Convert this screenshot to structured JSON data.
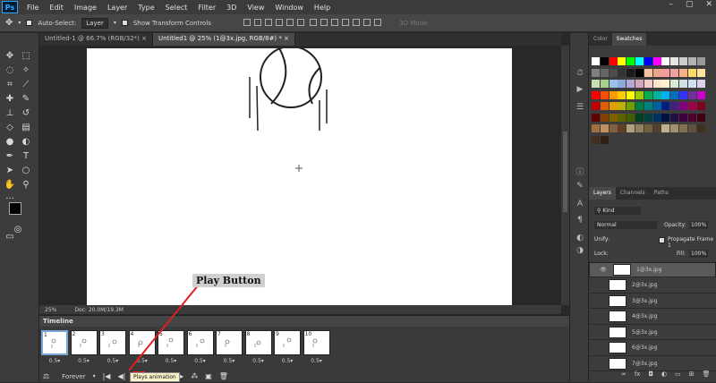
{
  "menubar": {
    "logo": "Ps",
    "items": [
      "File",
      "Edit",
      "Image",
      "Layer",
      "Type",
      "Select",
      "Filter",
      "3D",
      "View",
      "Window",
      "Help"
    ]
  },
  "options": {
    "auto_select": "Auto-Select:",
    "layer_select": "Layer",
    "show_transform": "Show Transform Controls",
    "mode_3d": "3D Mode:"
  },
  "tabs": [
    "Untitled-1 @ 66.7% (RGB/32*) ×",
    "Untitled1 @ 25% (1@3x.jpg, RGB/8#) * ×"
  ],
  "status": {
    "zoom": "25%",
    "doc": "Doc: 20.0M/19.3M"
  },
  "annotation": "Play Button",
  "timeline": {
    "title": "Timeline",
    "frames": [
      {
        "num": "1",
        "delay": "0.5"
      },
      {
        "num": "2",
        "delay": "0.5"
      },
      {
        "num": "3",
        "delay": "0.5"
      },
      {
        "num": "4",
        "delay": "0.5"
      },
      {
        "num": "5",
        "delay": "0.5"
      },
      {
        "num": "6",
        "delay": "0.5"
      },
      {
        "num": "7",
        "delay": "0.5"
      },
      {
        "num": "8",
        "delay": "0.5"
      },
      {
        "num": "9",
        "delay": "0.5"
      },
      {
        "num": "10",
        "delay": "0.5"
      }
    ],
    "loop": "Forever",
    "tooltip": "Plays animation"
  },
  "color_panel": {
    "tabs": [
      "Color",
      "Swatches"
    ]
  },
  "layers_panel": {
    "tabs": [
      "Layers",
      "Channels",
      "Paths"
    ],
    "kind": "Kind",
    "blend": "Normal",
    "opacity_label": "Opacity:",
    "opacity": "100%",
    "unify": "Unify:",
    "propagate": "Propagate Frame 1",
    "lock": "Lock:",
    "fill_label": "Fill:",
    "fill": "100%",
    "layers": [
      "1@3x.jpg",
      "2@3x.jpg",
      "3@3x.jpg",
      "4@3x.jpg",
      "5@3x.jpg",
      "6@3x.jpg",
      "7@3x.jpg"
    ],
    "bottom_icons": [
      "link-icon",
      "fx-icon",
      "mask-icon",
      "adjustment-icon",
      "group-icon",
      "new-layer-icon",
      "trash-icon"
    ]
  },
  "swatch_colors": [
    [
      "#ffffff",
      "#000000",
      "#ff0000",
      "#ffff00",
      "#00ff00",
      "#00ffff",
      "#0000ff",
      "#ff00ff",
      "#ffffff",
      "#e6e6e6",
      "#cccccc",
      "#b3b3b3",
      "#999999"
    ],
    [
      "#808080",
      "#666666",
      "#4d4d4d",
      "#333333",
      "#1a1a1a",
      "#000000",
      "#f4c2a1",
      "#e7a58a",
      "#f59c9c",
      "#f5a0a0",
      "#f4b183",
      "#ffd966",
      "#ffe699"
    ],
    [
      "#c6e0b4",
      "#a9d18e",
      "#9bc2e6",
      "#8eaadb",
      "#b4a7d6",
      "#d5a6bd",
      "#f4cccc",
      "#fce5cd",
      "#fff2cc",
      "#d9ead3",
      "#d0e0e3",
      "#cfe2f3",
      "#d9d2e9"
    ],
    [
      "#ff0000",
      "#ff4d00",
      "#ff9900",
      "#ffcc00",
      "#ffff00",
      "#99cc00",
      "#00b050",
      "#00b0a0",
      "#00b0f0",
      "#0070c0",
      "#3333ff",
      "#7030a0",
      "#cc00cc"
    ],
    [
      "#c00000",
      "#e06000",
      "#e0a000",
      "#c0b000",
      "#70a000",
      "#008040",
      "#008080",
      "#0060a0",
      "#002080",
      "#402080",
      "#800080",
      "#a0004a",
      "#800020"
    ],
    [
      "#600000",
      "#804000",
      "#806000",
      "#606000",
      "#406000",
      "#004020",
      "#004040",
      "#003060",
      "#001040",
      "#201040",
      "#400040",
      "#500030",
      "#400010"
    ],
    [
      "#a07040",
      "#c09060",
      "#806040",
      "#604020",
      "#b0a080",
      "#908060",
      "#706040",
      "#504030",
      "#c0b090",
      "#a09070",
      "#807050",
      "#605040",
      "#403020"
    ],
    [
      "#403020",
      "#302010"
    ]
  ]
}
